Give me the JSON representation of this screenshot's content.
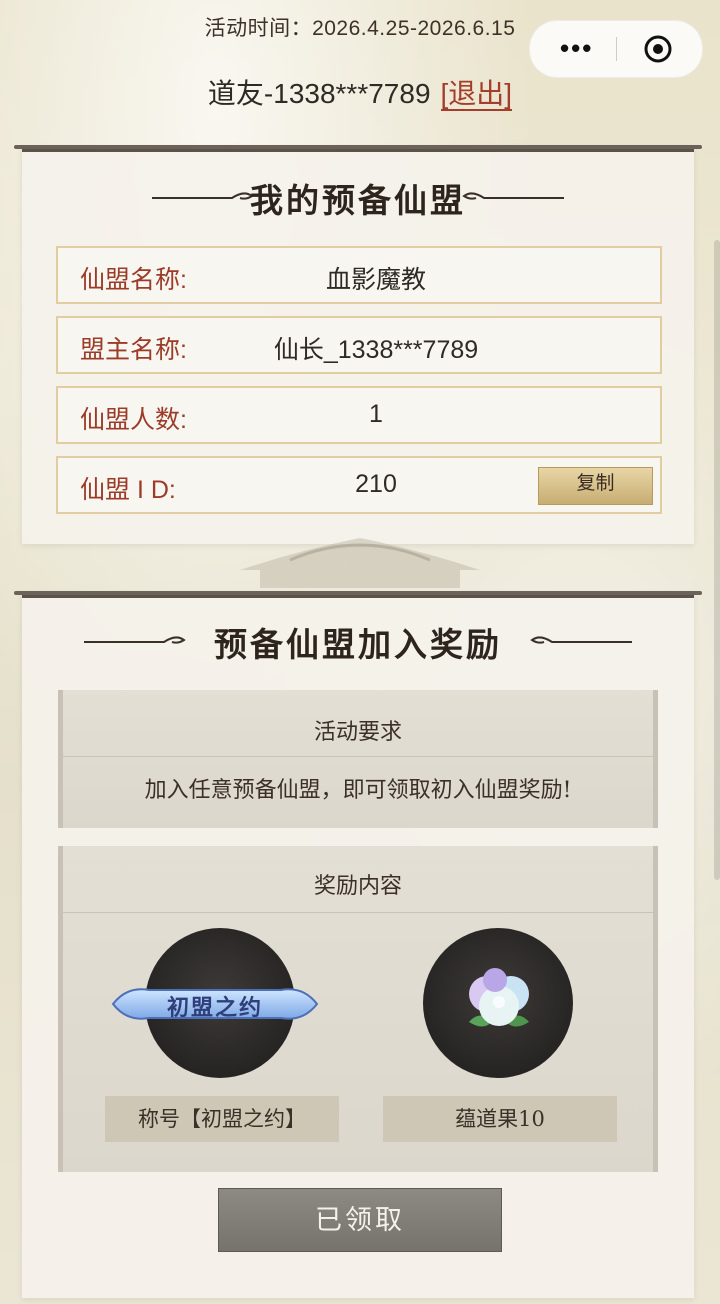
{
  "header": {
    "activity_time": "活动时间：2026.4.25-2026.6.15",
    "user": "道友-1338***7789",
    "logout_label": "[退出]"
  },
  "my_alliance": {
    "title": "我的预备仙盟",
    "rows": [
      {
        "label": "仙盟名称:",
        "value": "血影魔教"
      },
      {
        "label": "盟主名称:",
        "value": "仙长_1338***7789"
      },
      {
        "label": "仙盟人数:",
        "value": "1"
      },
      {
        "label": "仙盟 I D:",
        "value": "210"
      }
    ],
    "copy_label": "复制"
  },
  "rewards": {
    "title": "预备仙盟加入奖励",
    "requirement_title": "活动要求",
    "requirement_text": "加入任意预备仙盟，即可领取初入仙盟奖励!",
    "content_title": "奖励内容",
    "items": [
      {
        "badge_text": "初盟之约",
        "label": "称号【初盟之约】"
      },
      {
        "label": "蕴道果10"
      }
    ],
    "claim_label": "已领取"
  },
  "colors": {
    "accent_red": "#9b3b28",
    "gold": "#c7ad73",
    "disabled_button": "#7f7c76"
  }
}
